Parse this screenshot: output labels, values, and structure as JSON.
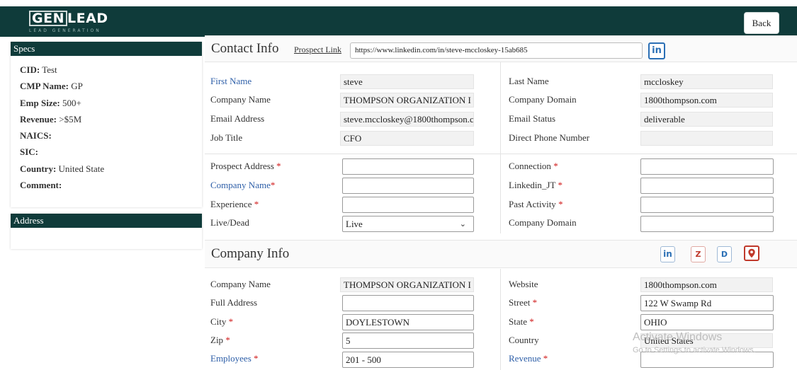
{
  "logo": {
    "part1": "GEN",
    "part2": "LEAD",
    "tagline": "LEAD GENERATION"
  },
  "header": {
    "back_label": "Back"
  },
  "specs": {
    "title": "Specs",
    "rows": [
      {
        "label": "CID:",
        "value": "Test"
      },
      {
        "label": "CMP Name:",
        "value": "GP"
      },
      {
        "label": "Emp Size:",
        "value": "500+"
      },
      {
        "label": "Revenue:",
        "value": ">$5M"
      },
      {
        "label": "NAICS:",
        "value": ""
      },
      {
        "label": "SIC:",
        "value": ""
      },
      {
        "label": "Country:",
        "value": "United State"
      },
      {
        "label": "Comment:",
        "value": ""
      }
    ]
  },
  "address_panel": {
    "title": "Address"
  },
  "contact_info": {
    "title": "Contact Info",
    "prospect_link_label": "Prospect Link",
    "prospect_link_value": "https://www.linkedin.com/in/steve-mccloskey-15ab685",
    "linkedin_btn": "in",
    "left": [
      {
        "label": "First Name",
        "value": "steve"
      },
      {
        "label": "Company Name",
        "value": "THOMPSON ORGANIZATION I"
      },
      {
        "label": "Email Address",
        "value": "steve.mccloskey@1800thompson.c"
      },
      {
        "label": "Job Title",
        "value": "CFO"
      }
    ],
    "right": [
      {
        "label": "Last Name",
        "value": "mccloskey"
      },
      {
        "label": "Company Domain",
        "value": "1800thompson.com"
      },
      {
        "label": "Email Status",
        "value": "deliverable"
      },
      {
        "label": "Direct Phone Number",
        "value": ""
      }
    ],
    "form_left": [
      {
        "label": "Prospect Address",
        "value": ""
      },
      {
        "label": "Company Name",
        "value": ""
      },
      {
        "label": "Experience",
        "value": ""
      },
      {
        "label": "Live/Dead",
        "value": "Live"
      }
    ],
    "form_right": [
      {
        "label": "Connection",
        "value": ""
      },
      {
        "label": "Linkedin_JT",
        "value": ""
      },
      {
        "label": "Past Activity",
        "value": ""
      },
      {
        "label": "Company Domain",
        "value": ""
      }
    ]
  },
  "company_info": {
    "title": "Company Info",
    "buttons": {
      "linkedin": "in",
      "z": "Z",
      "d": "D"
    },
    "left": [
      {
        "label": "Company Name",
        "value": "THOMPSON ORGANIZATION I"
      },
      {
        "label": "Full Address",
        "value": ""
      },
      {
        "label": "City",
        "value": "DOYLESTOWN"
      },
      {
        "label": "Zip",
        "value": "5"
      },
      {
        "label": "Employees",
        "value": "201 - 500"
      }
    ],
    "right": [
      {
        "label": "Website",
        "value": "1800thompson.com"
      },
      {
        "label": "Street",
        "value": "122 W Swamp Rd"
      },
      {
        "label": "State",
        "value": "OHIO"
      },
      {
        "label": "Country",
        "value": "United States"
      },
      {
        "label": "Revenue",
        "value": ""
      }
    ]
  },
  "watermark": {
    "line1": "Activate Windows",
    "line2": "Go to Settings to activate Windows."
  },
  "required_mark": "*",
  "colors": {
    "header_bg": "#0f3b3a",
    "label_blue": "#2e5fa8",
    "required_red": "#d01818",
    "linkedin_blue": "#2a6fb5",
    "z_red": "#c0392b"
  }
}
